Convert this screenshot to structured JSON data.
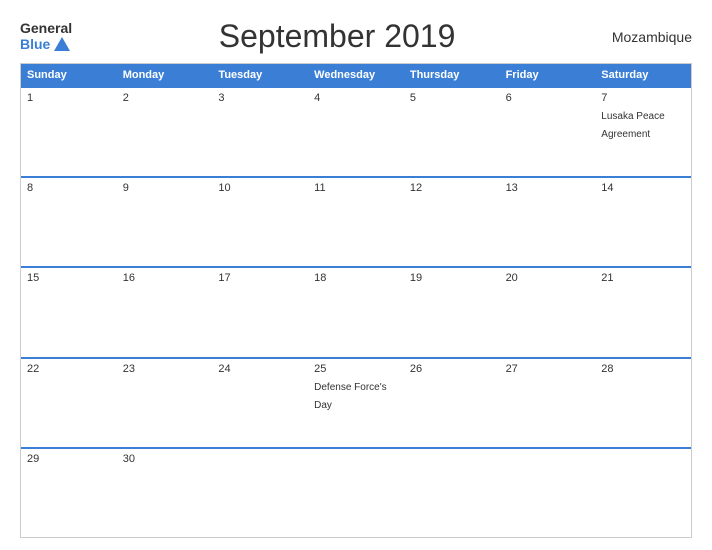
{
  "header": {
    "logo_general": "General",
    "logo_blue": "Blue",
    "title": "September 2019",
    "country": "Mozambique"
  },
  "calendar": {
    "days_of_week": [
      "Sunday",
      "Monday",
      "Tuesday",
      "Wednesday",
      "Thursday",
      "Friday",
      "Saturday"
    ],
    "weeks": [
      [
        {
          "day": "1",
          "event": ""
        },
        {
          "day": "2",
          "event": ""
        },
        {
          "day": "3",
          "event": ""
        },
        {
          "day": "4",
          "event": ""
        },
        {
          "day": "5",
          "event": ""
        },
        {
          "day": "6",
          "event": ""
        },
        {
          "day": "7",
          "event": "Lusaka Peace Agreement"
        }
      ],
      [
        {
          "day": "8",
          "event": ""
        },
        {
          "day": "9",
          "event": ""
        },
        {
          "day": "10",
          "event": ""
        },
        {
          "day": "11",
          "event": ""
        },
        {
          "day": "12",
          "event": ""
        },
        {
          "day": "13",
          "event": ""
        },
        {
          "day": "14",
          "event": ""
        }
      ],
      [
        {
          "day": "15",
          "event": ""
        },
        {
          "day": "16",
          "event": ""
        },
        {
          "day": "17",
          "event": ""
        },
        {
          "day": "18",
          "event": ""
        },
        {
          "day": "19",
          "event": ""
        },
        {
          "day": "20",
          "event": ""
        },
        {
          "day": "21",
          "event": ""
        }
      ],
      [
        {
          "day": "22",
          "event": ""
        },
        {
          "day": "23",
          "event": ""
        },
        {
          "day": "24",
          "event": ""
        },
        {
          "day": "25",
          "event": "Defense Force's Day"
        },
        {
          "day": "26",
          "event": ""
        },
        {
          "day": "27",
          "event": ""
        },
        {
          "day": "28",
          "event": ""
        }
      ],
      [
        {
          "day": "29",
          "event": ""
        },
        {
          "day": "30",
          "event": ""
        },
        {
          "day": "",
          "event": ""
        },
        {
          "day": "",
          "event": ""
        },
        {
          "day": "",
          "event": ""
        },
        {
          "day": "",
          "event": ""
        },
        {
          "day": "",
          "event": ""
        }
      ]
    ]
  }
}
